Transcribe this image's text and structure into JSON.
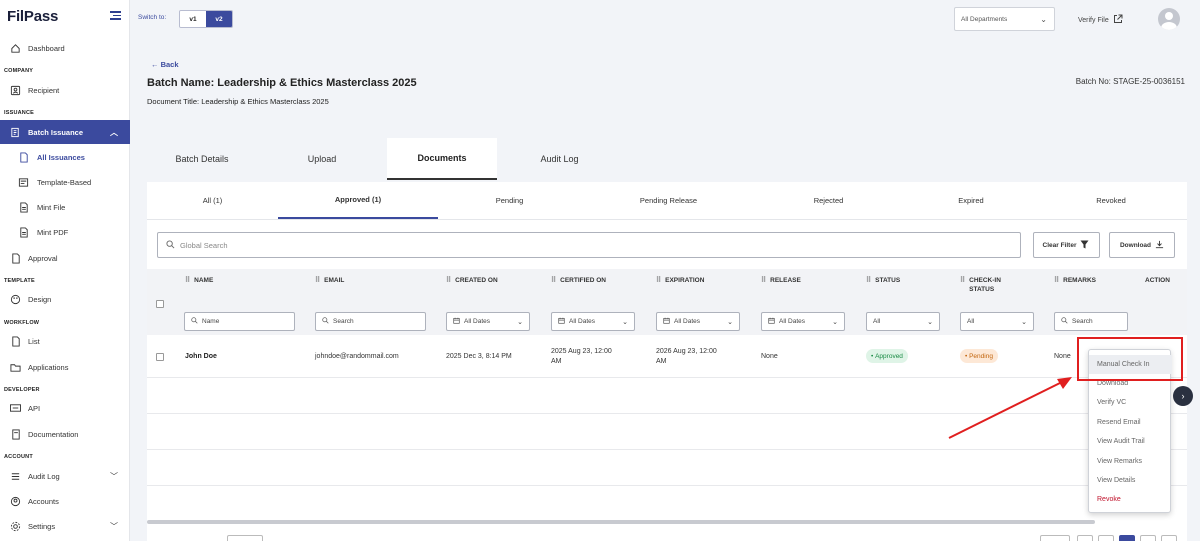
{
  "app": {
    "logo": "FilPass"
  },
  "sidebar": {
    "sections": {
      "company": "COMPANY",
      "issuance": "ISSUANCE",
      "template": "TEMPLATE",
      "workflow": "WORKFLOW",
      "developer": "DEVELOPER",
      "account": "ACCOUNT"
    },
    "items": {
      "dashboard": "Dashboard",
      "recipient": "Recipient",
      "batch_issuance": "Batch Issuance",
      "all_issuances": "All Issuances",
      "template_based": "Template-Based",
      "mint_file": "Mint File",
      "mint_pdf": "Mint PDF",
      "approval": "Approval",
      "design": "Design",
      "list": "List",
      "applications": "Applications",
      "api": "API",
      "documentation": "Documentation",
      "audit_log": "Audit Log",
      "accounts": "Accounts",
      "settings": "Settings"
    }
  },
  "topbar": {
    "switch_label": "Switch to:",
    "versions": [
      "v1",
      "v2"
    ],
    "selected_version": "v2",
    "department": "All Departments",
    "verify_file": "Verify File"
  },
  "page": {
    "back": "Back",
    "batch_name": "Batch Name: Leadership & Ethics Masterclass 2025",
    "document_title": "Document Title: Leadership & Ethics Masterclass 2025",
    "batch_no": "Batch No: STAGE-25-0036151"
  },
  "tabs": [
    "Batch Details",
    "Upload",
    "Documents",
    "Audit Log"
  ],
  "active_tab": "Documents",
  "subtabs": [
    "All (1)",
    "Approved (1)",
    "Pending",
    "Pending Release",
    "Rejected",
    "Expired",
    "Revoked"
  ],
  "active_subtab": "Approved (1)",
  "toolbar": {
    "search_placeholder": "Global Search",
    "clear_filter": "Clear Filter",
    "download": "Download"
  },
  "table": {
    "headers": {
      "name": "NAME",
      "email": "EMAIL",
      "created_on": "CREATED ON",
      "certified_on": "CERTIFIED ON",
      "expiration": "EXPIRATION",
      "release": "RELEASE",
      "status": "STATUS",
      "checkin_line1": "CHECK-IN",
      "checkin_line2": "STATUS",
      "remarks": "REMARKS",
      "action": "ACTION"
    },
    "filters": {
      "name": "Name",
      "email": "Search",
      "created_on": "All Dates",
      "certified_on": "All Dates",
      "expiration": "All Dates",
      "release": "All Dates",
      "status": "All",
      "checkin": "All",
      "remarks": "Search"
    },
    "rows": [
      {
        "name": "John Doe",
        "email": "johndoe@randommail.com",
        "created_on": "2025 Dec 3, 8:14 PM",
        "certified_on_line1": "2025 Aug 23, 12:00",
        "certified_on_line2": "AM",
        "expiration_line1": "2026 Aug 23, 12:00",
        "expiration_line2": "AM",
        "release": "None",
        "status": "Approved",
        "checkin": "Pending",
        "remarks": "None"
      }
    ]
  },
  "action_menu": [
    "Manual Check In",
    "Download",
    "Verify VC",
    "Resend Email",
    "View Audit Trail",
    "View Remarks",
    "View Details",
    "Revoke"
  ],
  "colors": {
    "primary": "#3b4a9e",
    "annotation": "#e01f1f",
    "approved": "#188a43",
    "pending": "#c2640c",
    "revoke": "#c0122b"
  }
}
